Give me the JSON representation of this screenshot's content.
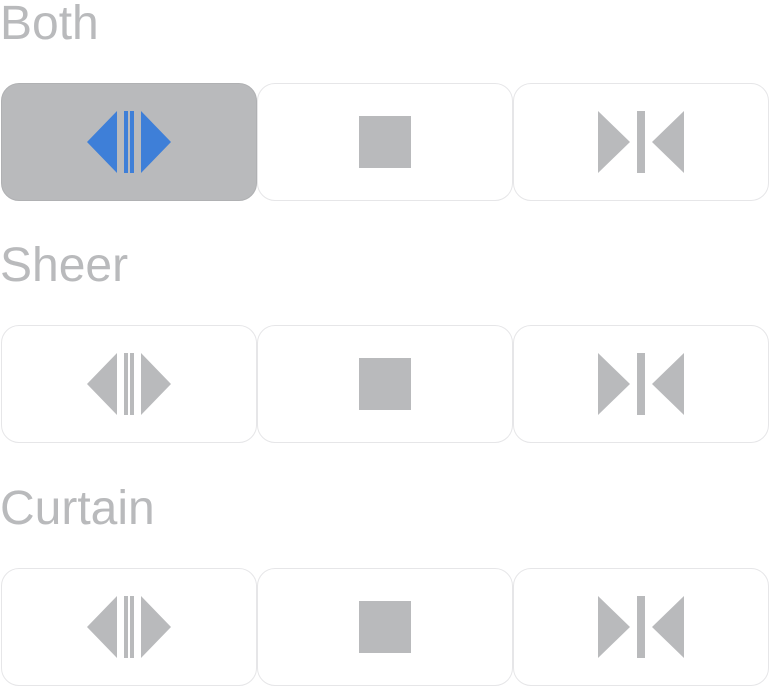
{
  "colors": {
    "label": "#b9babc",
    "icon_default": "#b9babc",
    "icon_selected": "#3e7fd8",
    "selected_background": "#b9babc",
    "border": "#e6e6e8"
  },
  "groups": [
    {
      "label": "Both",
      "buttons": [
        {
          "icon": "open-icon",
          "selected": true
        },
        {
          "icon": "stop-icon",
          "selected": false
        },
        {
          "icon": "close-icon",
          "selected": false
        }
      ]
    },
    {
      "label": "Sheer",
      "buttons": [
        {
          "icon": "open-icon",
          "selected": false
        },
        {
          "icon": "stop-icon",
          "selected": false
        },
        {
          "icon": "close-icon",
          "selected": false
        }
      ]
    },
    {
      "label": "Curtain",
      "buttons": [
        {
          "icon": "open-icon",
          "selected": false
        },
        {
          "icon": "stop-icon",
          "selected": false
        },
        {
          "icon": "close-icon",
          "selected": false
        }
      ]
    }
  ]
}
